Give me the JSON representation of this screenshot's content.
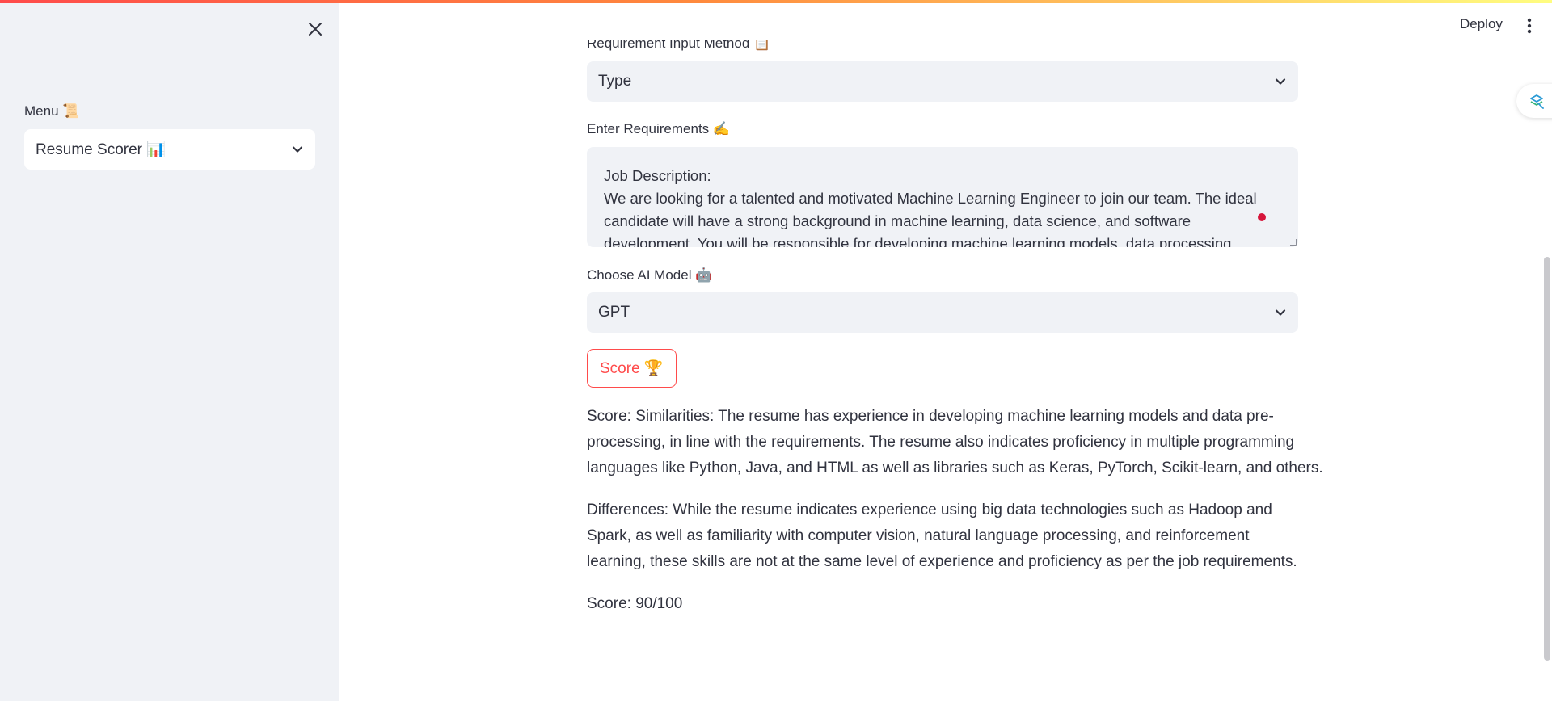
{
  "sidebar": {
    "menu_label": "Menu 📜",
    "menu_value": "Resume Scorer 📊"
  },
  "header": {
    "deploy_label": "Deploy"
  },
  "main": {
    "input_method_label": "Requirement Input Method 📋",
    "input_method_value": "Type",
    "requirements_label": "Enter Requirements ✍️",
    "requirements_lines": [
      "Job Description:",
      "We are looking for a talented and motivated Machine Learning Engineer to join our team. The ideal",
      "candidate will have a strong background in machine learning, data science, and software",
      "development. You will be responsible for developing machine learning models, data processing,"
    ],
    "model_label": "Choose AI Model 🤖",
    "model_value": "GPT",
    "score_button_label": "Score 🏆",
    "result_similarities_lines": [
      "Score: Similarities: The resume has experience in developing machine learning models and data pre-",
      "processing, in line with the requirements. The resume also indicates proficiency in multiple programming",
      "languages like Python, Java, and HTML as well as libraries such as Keras, PyTorch, Scikit-learn, and others."
    ],
    "result_differences_lines": [
      "Differences: While the resume indicates experience using big data technologies such as Hadoop and",
      "Spark, as well as familiarity with computer vision, natural language processing, and reinforcement",
      "learning, these skills are not at the same level of experience and proficiency as per the job requirements."
    ],
    "result_score": "Score: 90/100"
  },
  "colors": {
    "accent": "#ff4b4b",
    "sidebar_bg": "#f0f2f6",
    "text": "#31333f",
    "record_dot": "#d6163b"
  },
  "icons": {
    "close": "close-icon",
    "chevron": "chevron-down-icon",
    "kebab": "more-vertical-icon",
    "float": "app-logo-icon"
  }
}
